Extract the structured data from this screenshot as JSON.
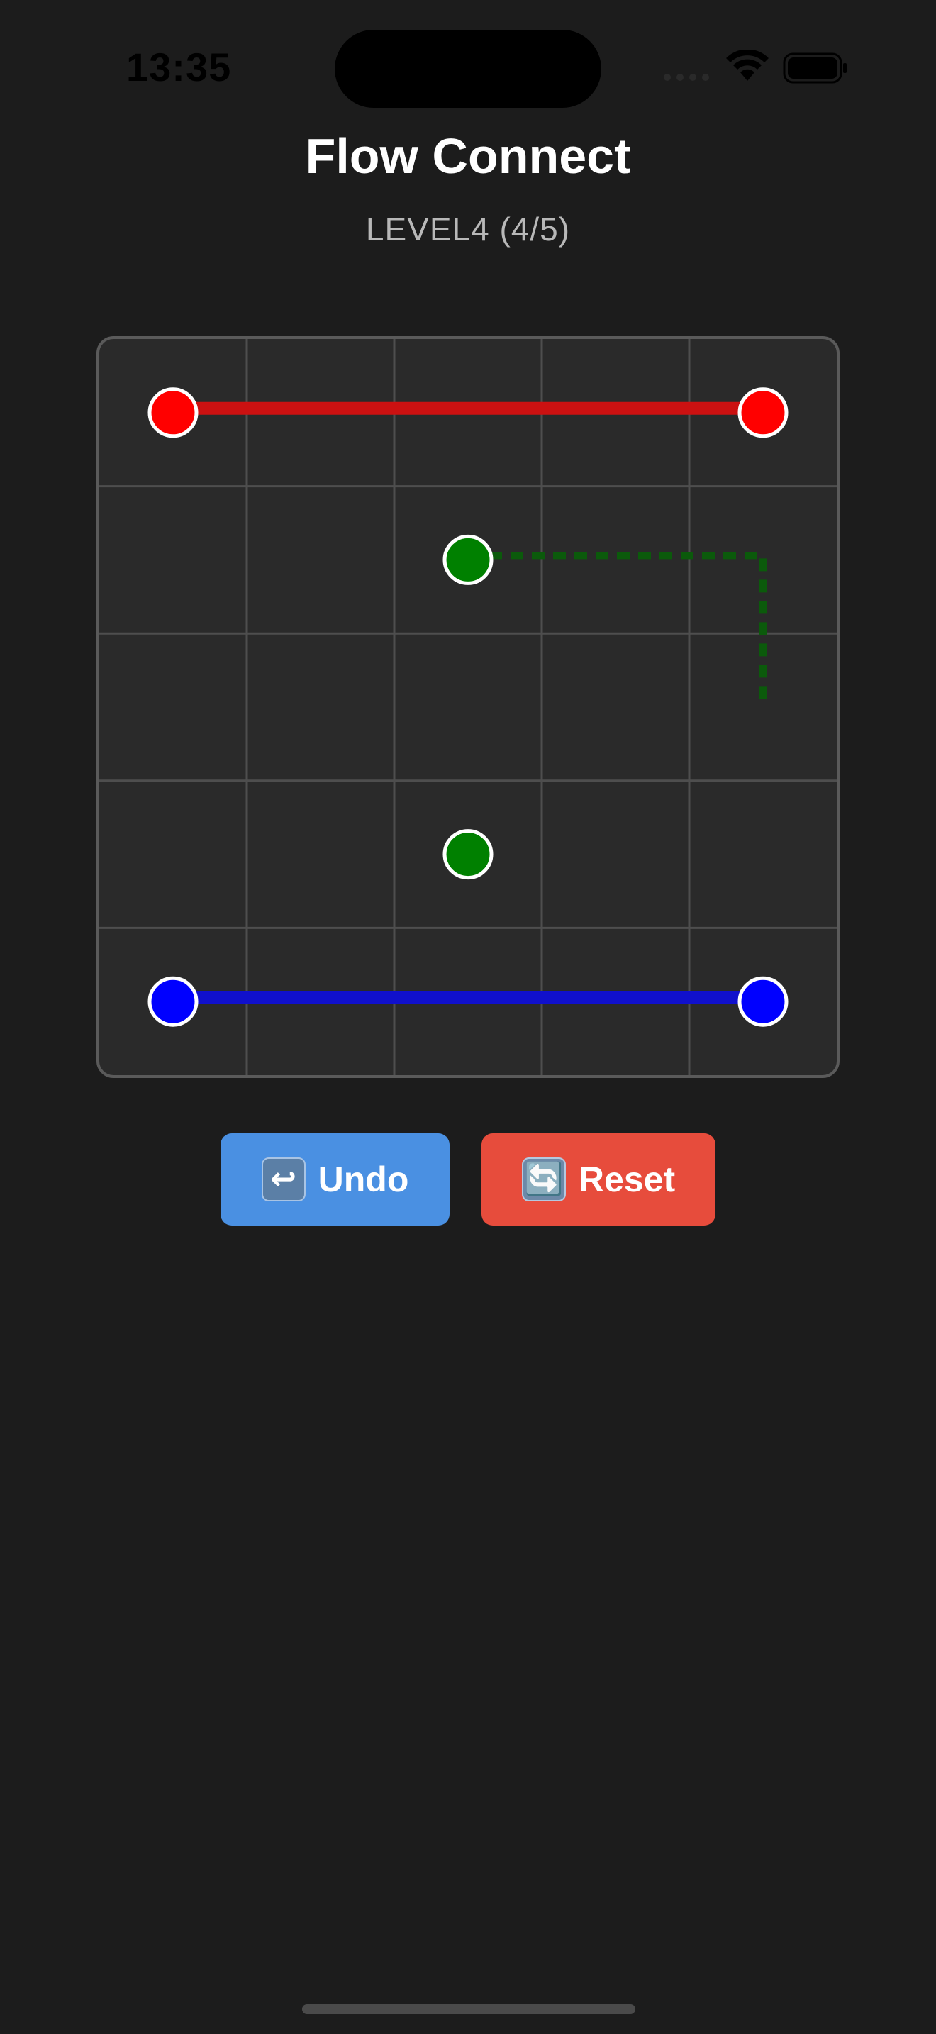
{
  "status_bar": {
    "time": "13:35"
  },
  "header": {
    "title": "Flow Connect",
    "level": "LEVEL4 (4/5)"
  },
  "board": {
    "rows": 5,
    "cols": 5,
    "colors": {
      "red": "#ff0000",
      "green": "#008000",
      "blue": "#0000ff"
    },
    "dots": [
      {
        "color": "red",
        "row": 0,
        "col": 0
      },
      {
        "color": "red",
        "row": 0,
        "col": 4
      },
      {
        "color": "green",
        "row": 1,
        "col": 2
      },
      {
        "color": "green",
        "row": 3,
        "col": 2
      },
      {
        "color": "blue",
        "row": 4,
        "col": 0
      },
      {
        "color": "blue",
        "row": 4,
        "col": 4
      }
    ],
    "paths": [
      {
        "color": "red",
        "style": "solid",
        "cells": [
          [
            0,
            0
          ],
          [
            0,
            1
          ],
          [
            0,
            2
          ],
          [
            0,
            3
          ],
          [
            0,
            4
          ]
        ]
      },
      {
        "color": "blue",
        "style": "solid",
        "cells": [
          [
            4,
            0
          ],
          [
            4,
            1
          ],
          [
            4,
            2
          ],
          [
            4,
            3
          ],
          [
            4,
            4
          ]
        ]
      },
      {
        "color": "green",
        "style": "dashed",
        "cells": [
          [
            1,
            2
          ],
          [
            1,
            3
          ],
          [
            1,
            4
          ],
          [
            2,
            4
          ]
        ]
      }
    ]
  },
  "buttons": {
    "undo": {
      "icon": "↩",
      "label": "Undo",
      "icon_name": "undo-icon"
    },
    "reset": {
      "icon": "🔄",
      "label": "Reset",
      "icon_name": "reset-icon"
    }
  }
}
